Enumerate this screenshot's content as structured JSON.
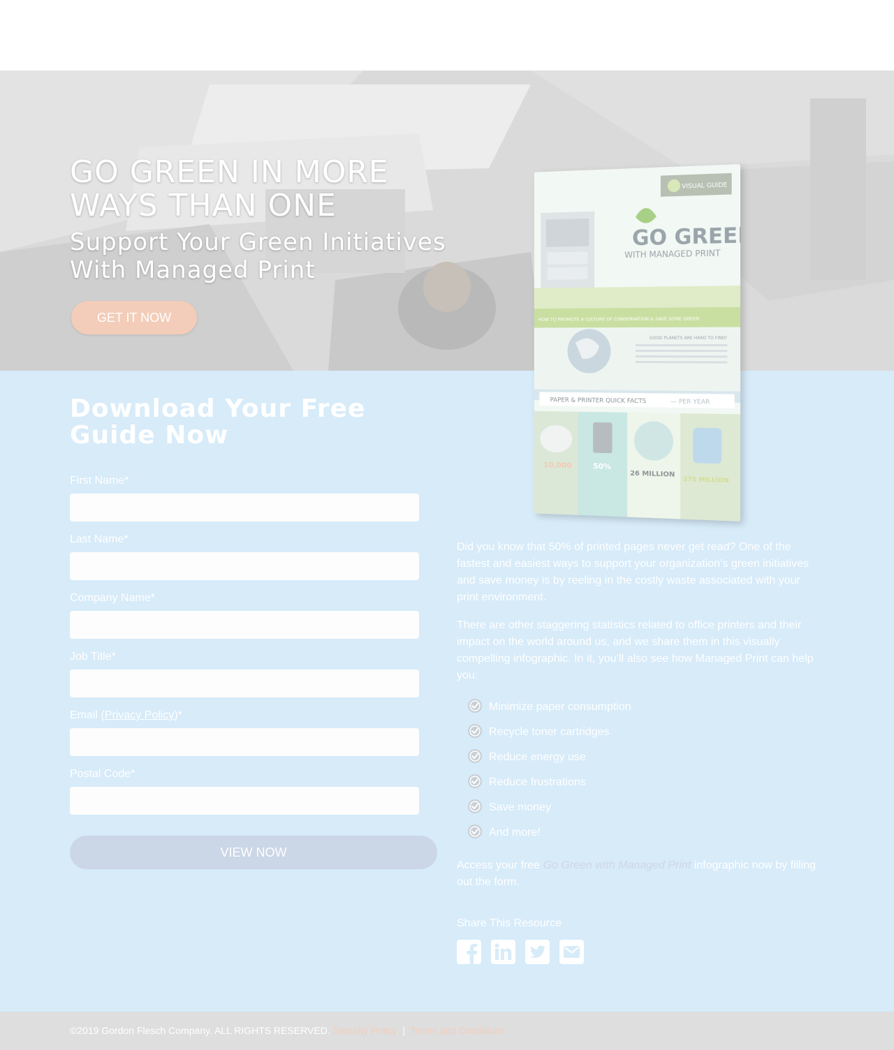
{
  "hero": {
    "title": "GO GREEN IN MORE WAYS THAN ONE",
    "subtitle": "Support Your Green Initiatives With Managed Print",
    "cta_label": "GET IT NOW"
  },
  "book": {
    "badge": "VISUAL GUIDE",
    "title": "GO GREEN",
    "subtitle": "WITH MANAGED PRINT",
    "banner": "HOW TO PROMOTE A CULTURE OF CONSERVATION & SAVE SOME GREEN",
    "planet_heading": "GOOD PLANETS ARE HARD TO FIND!",
    "facts_heading": "PAPER & PRINTER QUICK FACTS",
    "facts_suffix": "— PER YEAR",
    "stats": [
      "10,000",
      "50%",
      "26 MILLION",
      "375 MILLION"
    ]
  },
  "form": {
    "title": "Download Your Free Guide Now",
    "fields": [
      {
        "label": "First Name*",
        "value": ""
      },
      {
        "label": "Last Name*",
        "value": ""
      },
      {
        "label": "Company Name*",
        "value": ""
      },
      {
        "label": "Job Title*",
        "value": ""
      },
      {
        "label": "Postal Code*",
        "value": ""
      }
    ],
    "email_label_prefix": "Email (",
    "email_link": "Privacy Policy",
    "email_label_suffix": ")*",
    "submit_label": "VIEW NOW"
  },
  "content": {
    "para1": "Did you know that 50% of printed pages never get read? One of the fastest and easiest ways to support your organization’s green initiatives and save money is by reeling in the costly waste associated with your print environment.",
    "para2": "There are other staggering statistics related to office printers and their impact on the world around us, and we share them in this visually compelling infographic. In it, you’ll also see how Managed Print can help you:",
    "checklist": [
      "Minimize paper consumption",
      "Recycle toner cartridges",
      "Reduce energy use",
      "Reduce frustrations",
      "Save money",
      "And more!"
    ],
    "access_prefix": "Access your free ",
    "access_emphasis": "Go Green with Managed Print",
    "access_suffix": " infographic now by filling out the form.",
    "share_title": "Share This Resource",
    "share_icons": [
      "facebook-icon",
      "linkedin-icon",
      "twitter-icon",
      "email-icon"
    ]
  },
  "footer": {
    "copyright": "©2019 Gordon Flesch Company. ALL RIGHTS RESERVED.",
    "security_link": "Security Policy",
    "separator": "|",
    "terms_link": "Terms and Conditions"
  },
  "colors": {
    "accent": "#f3cdb9",
    "main_bg": "#d7ebf9",
    "submit_bg": "#cbd6e6",
    "footer_bg": "#dedede"
  }
}
